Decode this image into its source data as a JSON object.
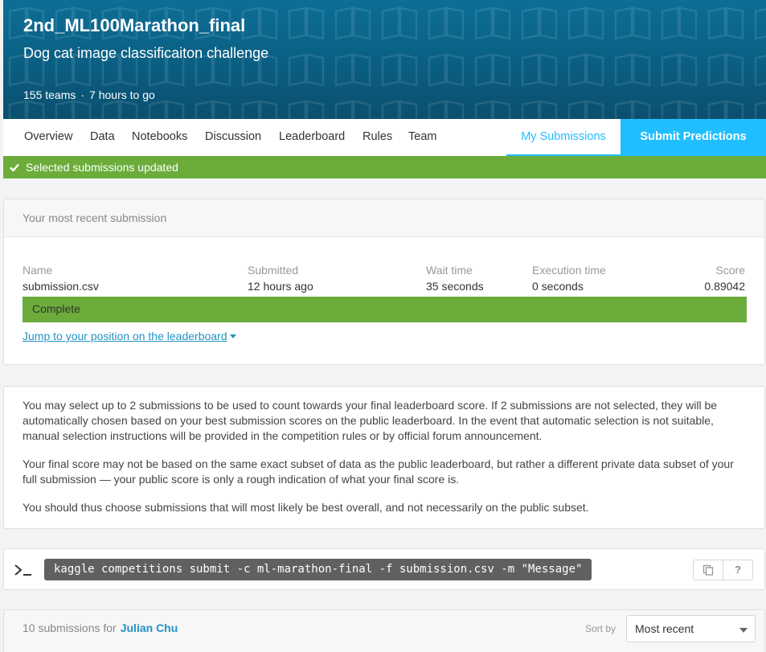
{
  "hero": {
    "title": "2nd_ML100Marathon_final",
    "subtitle": "Dog cat image classificaiton challenge",
    "teams": "155 teams",
    "separator": "·",
    "time_left": "7 hours to go"
  },
  "nav": {
    "items": [
      "Overview",
      "Data",
      "Notebooks",
      "Discussion",
      "Leaderboard",
      "Rules",
      "Team"
    ],
    "my_submissions": "My Submissions",
    "submit_predictions": "Submit Predictions"
  },
  "banner": {
    "message": "Selected submissions updated",
    "icon": "check-icon"
  },
  "recent": {
    "heading": "Your most recent submission",
    "labels": {
      "name": "Name",
      "submitted": "Submitted",
      "wait": "Wait time",
      "exec": "Execution time",
      "score": "Score"
    },
    "values": {
      "name": "submission.csv",
      "submitted": "12 hours ago",
      "wait": "35 seconds",
      "exec": "0 seconds",
      "score": "0.89042"
    },
    "status": "Complete",
    "jump_link": "Jump to your position on the leaderboard"
  },
  "info": {
    "p1": "You may select up to 2 submissions to be used to count towards your final leaderboard score. If 2 submissions are not selected, they will be automatically chosen based on your best submission scores on the public leaderboard. In the event that automatic selection is not suitable, manual selection instructions will be provided in the competition rules or by official forum announcement.",
    "p2": "Your final score may not be based on the same exact subset of data as the public leaderboard, but rather a different private data subset of your full submission — your public score is only a rough indication of what your final score is.",
    "p3": "You should thus choose submissions that will most likely be best overall, and not necessarily on the public subset."
  },
  "api": {
    "command": "kaggle competitions submit -c ml-marathon-final -f submission.csv -m \"Message\"",
    "help": "?"
  },
  "submissions": {
    "count_label": "10 submissions for",
    "user": "Julian Chu",
    "sort_label": "Sort by",
    "sort_value": "Most recent"
  },
  "colors": {
    "accent": "#20beff",
    "success": "#6bac3b",
    "link": "#2493c6",
    "hero": "#0a5e82"
  }
}
